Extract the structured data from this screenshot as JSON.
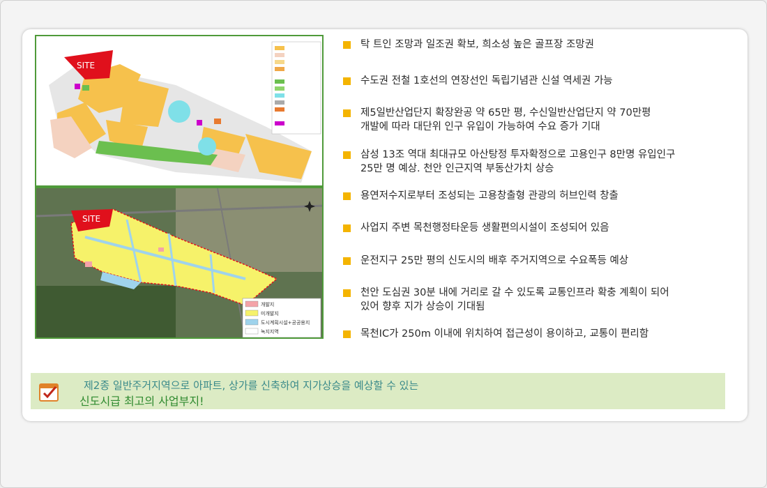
{
  "maps": {
    "site_label_top": "SITE",
    "site_label_bottom": "SITE",
    "bottom_legend": [
      {
        "label": "개발지",
        "color": "#f4a3a8"
      },
      {
        "label": "미개발지",
        "color": "#f6f26a"
      },
      {
        "label": "도시계획시설+공공용지",
        "color": "#9fd3ec"
      },
      {
        "label": "녹지지역",
        "color": "#ffffff"
      }
    ],
    "colors": {
      "site": "#e0101c",
      "residential": "#f6c14c",
      "light_pink": "#f4d2c0",
      "green": "#6bbf4f",
      "cyan": "#7fe0e8",
      "purple": "#cc00cc",
      "boundary": "#e0101c",
      "undeveloped": "#f6f26a",
      "facility": "#9fd3ec"
    }
  },
  "bullets": [
    "탁 트인 조망과 일조권 확보, 희소성 높은 골프장 조망권",
    "수도권 전철 1호선의 연장선인 독립기념관 신설 역세권 가능",
    "제5일반산업단지 확장완공 약 65만 평, 수신일반산업단지 약 70만평\n개발에 따라 대단위 인구 유입이 가능하여 수요 증가 기대",
    "삼성 13조 역대 최대규모 아산탕정 투자확정으로 고용인구 8만명 유입인구\n25만 명 예상. 천안 인근지역 부동산가치 상승",
    "용연저수지로부터 조성되는 고용창출형 관광의 허브인력 창출",
    "사업지 주변 목천행정타운등 생활편의시설이 조성되어 있음",
    "운전지구 25만 평의 신도시의 배후 주거지역으로 수요폭등 예상",
    "천안 도심권 30분 내에 거리로 갈 수 있도록 교통인프라 확충 계획이 되어\n있어 향후 지가 상승이 기대됨",
    "목천IC가 250m 이내에 위치하여 접근성이 용이하고, 교통이 편리함"
  ],
  "bullet_color": "#f4b400",
  "banner": {
    "line1": "제2종 일반주거지역으로 아파트, 상가를 신축하여 지가상승을 예상할 수 있는",
    "line2": "신도시급 최고의 사업부지!",
    "background": "#dcebc4",
    "icon": "checklist-icon"
  }
}
